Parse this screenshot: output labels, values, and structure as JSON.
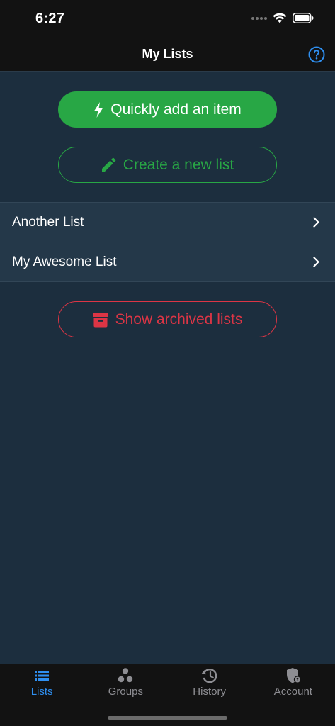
{
  "status_bar": {
    "time": "6:27"
  },
  "nav": {
    "title": "My Lists"
  },
  "actions": {
    "quick_add_label": "Quickly add an item",
    "create_list_label": "Create a new list",
    "show_archived_label": "Show archived lists"
  },
  "lists": [
    {
      "name": "Another List"
    },
    {
      "name": "My Awesome List"
    }
  ],
  "tabs": [
    {
      "label": "Lists",
      "icon": "list-icon",
      "active": true
    },
    {
      "label": "Groups",
      "icon": "groups-icon",
      "active": false
    },
    {
      "label": "History",
      "icon": "history-icon",
      "active": false
    },
    {
      "label": "Account",
      "icon": "account-shield-icon",
      "active": false
    }
  ],
  "colors": {
    "background": "#1c2e3e",
    "bar": "#121212",
    "success": "#28a745",
    "danger": "#dc3545",
    "accent": "#2f8ff0"
  }
}
